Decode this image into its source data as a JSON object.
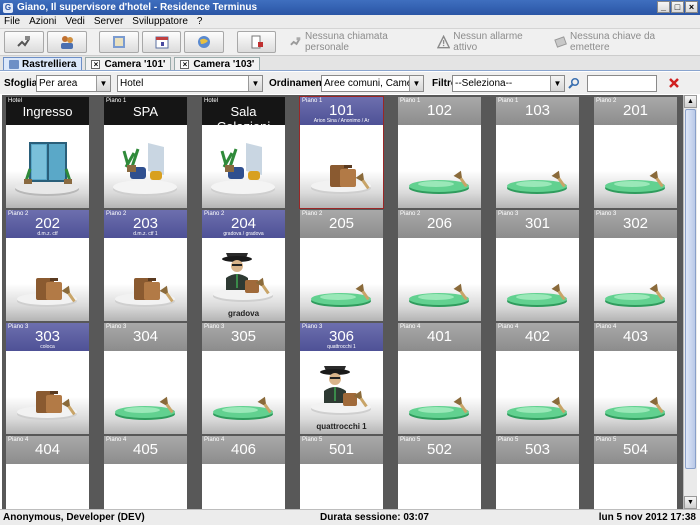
{
  "window": {
    "title": "Giano, Il supervisore d'hotel - Residence Terminus"
  },
  "menu": [
    "File",
    "Azioni",
    "Vedi",
    "Server",
    "Sviluppatore",
    "?"
  ],
  "toolbar": {
    "buttons": [
      "phone-icon",
      "users-icon",
      "book-icon",
      "calendar-icon",
      "globe-icon",
      "exit-icon"
    ],
    "status": [
      {
        "icon": "phone-off-icon",
        "label": "Nessuna chiamata personale"
      },
      {
        "icon": "alarm-icon",
        "label": "Nessun allarme attivo"
      },
      {
        "icon": "key-icon",
        "label": "Nessuna chiave da emettere"
      }
    ]
  },
  "tabs": [
    {
      "label": "Rastrelliera",
      "active": true
    },
    {
      "label": "Camera '101'",
      "active": false
    },
    {
      "label": "Camera '103'",
      "active": false
    }
  ],
  "filters": {
    "sfoglia_label": "Sfoglia",
    "sfoglia_value": "Per area",
    "area_value": "Hotel",
    "ordinamento_label": "Ordinamento",
    "ordinamento_value": "Aree comuni, Camere",
    "filtro_label": "Filtro",
    "filtro_value": "--Seleziona--",
    "search_value": ""
  },
  "rooms": [
    {
      "floor": "Hotel",
      "name": "Ingresso",
      "style": "black",
      "pic": "lobby"
    },
    {
      "floor": "Piano 1",
      "name": "SPA",
      "style": "black",
      "pic": "lounge"
    },
    {
      "floor": "Hotel",
      "name": "Sala Colazioni",
      "style": "black",
      "pic": "lounge"
    },
    {
      "floor": "Piano 1",
      "name": "101",
      "style": "purple",
      "guest": "Arion Sina / Anonimo / Ar",
      "pic": "luggage",
      "selected": true
    },
    {
      "floor": "Piano 1",
      "name": "102",
      "style": "gray",
      "pic": "free"
    },
    {
      "floor": "Piano 1",
      "name": "103",
      "style": "gray",
      "pic": "free"
    },
    {
      "floor": "Piano 2",
      "name": "201",
      "style": "gray",
      "pic": "free"
    },
    {
      "floor": "Piano 2",
      "name": "202",
      "style": "purple",
      "guest": "d.m.z. ctf",
      "pic": "luggage"
    },
    {
      "floor": "Piano 2",
      "name": "203",
      "style": "purple",
      "guest": "d.m.z. ctf 1",
      "pic": "luggage"
    },
    {
      "floor": "Piano 2",
      "name": "204",
      "style": "purple",
      "guest": "gradova / gradova",
      "pic": "person",
      "occupant": "gradova"
    },
    {
      "floor": "Piano 2",
      "name": "205",
      "style": "gray",
      "pic": "free"
    },
    {
      "floor": "Piano 2",
      "name": "206",
      "style": "gray",
      "pic": "free"
    },
    {
      "floor": "Piano 3",
      "name": "301",
      "style": "gray",
      "pic": "free"
    },
    {
      "floor": "Piano 3",
      "name": "302",
      "style": "gray",
      "pic": "free"
    },
    {
      "floor": "Piano 3",
      "name": "303",
      "style": "purple",
      "guest": "coloca",
      "pic": "luggage"
    },
    {
      "floor": "Piano 3",
      "name": "304",
      "style": "gray",
      "pic": "free"
    },
    {
      "floor": "Piano 3",
      "name": "305",
      "style": "gray",
      "pic": "free"
    },
    {
      "floor": "Piano 3",
      "name": "306",
      "style": "purple",
      "guest": "quattrocchi 1",
      "pic": "person",
      "occupant": "quattrocchi 1"
    },
    {
      "floor": "Piano 4",
      "name": "401",
      "style": "gray",
      "pic": "free"
    },
    {
      "floor": "Piano 4",
      "name": "402",
      "style": "gray",
      "pic": "free"
    },
    {
      "floor": "Piano 4",
      "name": "403",
      "style": "gray",
      "pic": "free"
    },
    {
      "floor": "Piano 4",
      "name": "404",
      "style": "gray",
      "pic": "free"
    },
    {
      "floor": "Piano 4",
      "name": "405",
      "style": "gray",
      "pic": "free"
    },
    {
      "floor": "Piano 4",
      "name": "406",
      "style": "gray",
      "pic": "free"
    },
    {
      "floor": "Piano 5",
      "name": "501",
      "style": "gray",
      "pic": "free"
    },
    {
      "floor": "Piano 5",
      "name": "502",
      "style": "gray",
      "pic": "free"
    },
    {
      "floor": "Piano 5",
      "name": "503",
      "style": "gray",
      "pic": "free"
    },
    {
      "floor": "Piano 5",
      "name": "504",
      "style": "gray",
      "pic": "free"
    }
  ],
  "status": {
    "user": "Anonymous, Developer (DEV)",
    "session": "Durata sessione: 03:07",
    "datetime": "lun 5 nov 2012 17:38"
  },
  "colors": {
    "selected_border": "#9b2626",
    "occupied_header": "#5b5ea3",
    "free_header": "#9a9a9a"
  }
}
